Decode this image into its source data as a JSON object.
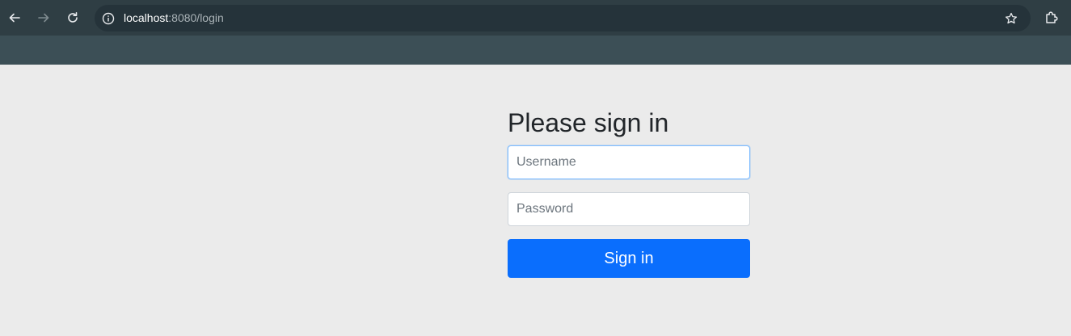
{
  "browser": {
    "url_host": "localhost",
    "url_path": ":8080/login",
    "icons": {
      "back": "arrow-left-icon",
      "forward": "arrow-right-icon",
      "reload": "reload-icon",
      "site_info": "info-icon",
      "bookmark": "star-icon",
      "extensions": "puzzle-icon"
    },
    "colors": {
      "toolbar": "#2f3e44",
      "tabstrip": "#3c4f56",
      "omnibox": "#25333a"
    }
  },
  "login": {
    "heading": "Please sign in",
    "username_placeholder": "Username",
    "password_placeholder": "Password",
    "submit_label": "Sign in",
    "accent_color": "#0a6efd"
  }
}
